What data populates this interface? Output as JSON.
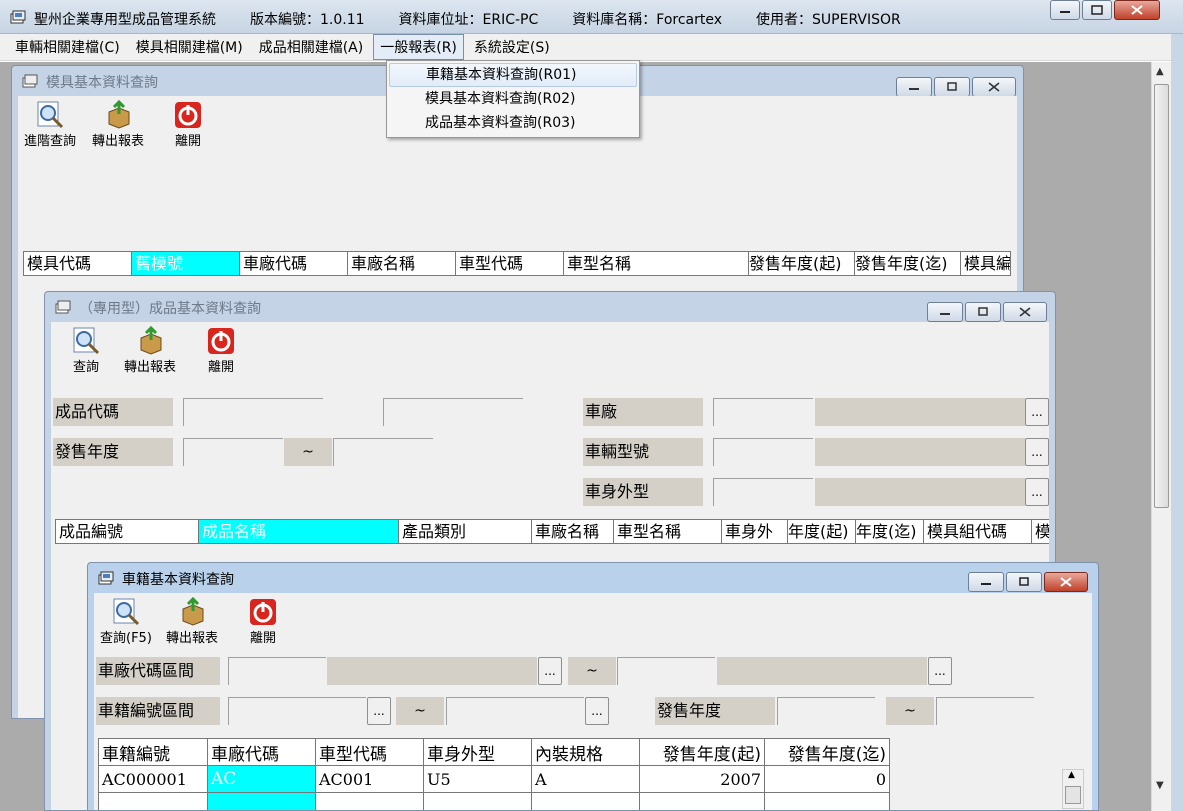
{
  "main": {
    "title_parts": [
      "聖州企業專用型成品管理系統",
      "版本編號：1.0.11",
      "資料庫位址：ERIC-PC",
      "資料庫名稱：Forcartex",
      "使用者：SUPERVISOR"
    ]
  },
  "menu": {
    "items": [
      "車輛相關建檔(C)",
      "模具相關建檔(M)",
      "成品相關建檔(A)",
      "一般報表(R)",
      "系統設定(S)"
    ],
    "open_index": 3,
    "dropdown": [
      "車籍基本資料查詢(R01)",
      "模具基本資料查詢(R02)",
      "成品基本資料查詢(R03)"
    ]
  },
  "win_mold": {
    "title": "模具基本資料查詢",
    "toolbar": [
      "進階查詢",
      "轉出報表",
      "離開"
    ],
    "columns": [
      "模具代碼",
      "舊模號",
      "車廠代碼",
      "車廠名稱",
      "車型代碼",
      "車型名稱",
      "發售年度(起)",
      "發售年度(迄)",
      "模具編"
    ]
  },
  "win_product": {
    "title": "（專用型）成品基本資料查詢",
    "toolbar": [
      "查詢",
      "轉出報表",
      "離開"
    ],
    "labels": {
      "code": "成品代碼",
      "year": "發售年度",
      "factory": "車廠",
      "model": "車輛型號",
      "body": "車身外型"
    },
    "tilde": "~",
    "dots": "...",
    "columns": [
      "成品編號",
      "成品名稱",
      "產品類別",
      "車廠名稱",
      "車型名稱",
      "車身外",
      "年度(起)",
      "年度(迄)",
      "模具組代碼",
      "模"
    ]
  },
  "win_vehicle": {
    "title": "車籍基本資料查詢",
    "toolbar": [
      "查詢(F5)",
      "轉出報表",
      "離開"
    ],
    "labels": {
      "factory_range": "車廠代碼區間",
      "vehicle_range": "車籍編號區間",
      "year": "發售年度"
    },
    "tilde": "~",
    "dots": "...",
    "columns": [
      "車籍編號",
      "車廠代碼",
      "車型代碼",
      "車身外型",
      "內裝規格",
      "發售年度(起)",
      "發售年度(迄)"
    ],
    "rows": [
      [
        "AC000001",
        "AC",
        "AC001",
        "U5",
        "A",
        "2007",
        "0"
      ]
    ]
  },
  "colors": {
    "selected_cell": "#00ffff",
    "field_label_bg": "#d4d0c8",
    "mdi_bg": "#ababab",
    "title_active": "#c4d3e6"
  }
}
